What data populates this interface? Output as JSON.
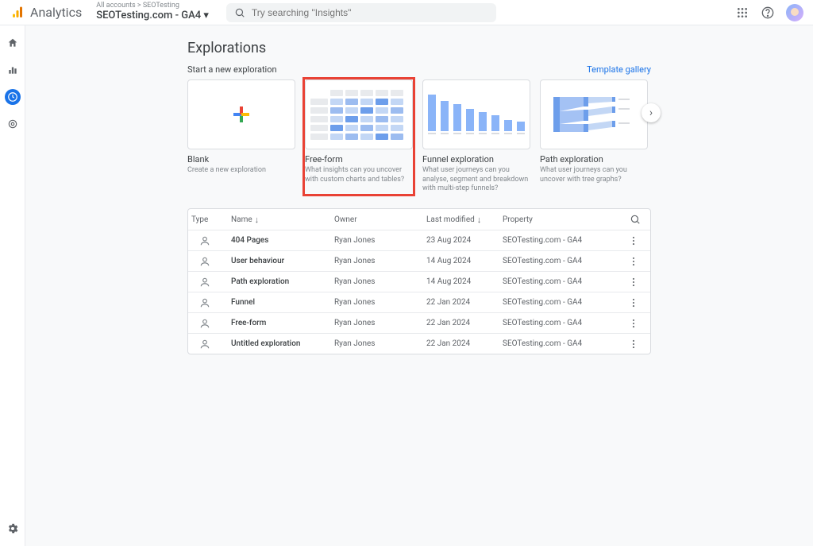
{
  "header": {
    "brand": "Analytics",
    "breadcrumb": "All accounts > SEOTesting",
    "property": "SEOTesting.com - GA4",
    "search_placeholder": "Try searching \"Insights\""
  },
  "page": {
    "title": "Explorations",
    "subtitle": "Start a new exploration",
    "gallery_link": "Template gallery"
  },
  "templates": [
    {
      "title": "Blank",
      "desc": "Create a new exploration"
    },
    {
      "title": "Free-form",
      "desc": "What insights can you uncover with custom charts and tables?"
    },
    {
      "title": "Funnel exploration",
      "desc": "What user journeys can you analyse, segment and breakdown with multi-step funnels?"
    },
    {
      "title": "Path exploration",
      "desc": "What user journeys can you uncover with tree graphs?"
    }
  ],
  "table": {
    "headers": {
      "type": "Type",
      "name": "Name",
      "owner": "Owner",
      "last_modified": "Last modified",
      "property": "Property"
    },
    "rows": [
      {
        "name": "404 Pages",
        "owner": "Ryan Jones",
        "modified": "23 Aug 2024",
        "property": "SEOTesting.com - GA4"
      },
      {
        "name": "User behaviour",
        "owner": "Ryan Jones",
        "modified": "14 Aug 2024",
        "property": "SEOTesting.com - GA4"
      },
      {
        "name": "Path exploration",
        "owner": "Ryan Jones",
        "modified": "14 Aug 2024",
        "property": "SEOTesting.com - GA4"
      },
      {
        "name": "Funnel",
        "owner": "Ryan Jones",
        "modified": "22 Jan 2024",
        "property": "SEOTesting.com - GA4"
      },
      {
        "name": "Free-form",
        "owner": "Ryan Jones",
        "modified": "22 Jan 2024",
        "property": "SEOTesting.com - GA4"
      },
      {
        "name": "Untitled exploration",
        "owner": "Ryan Jones",
        "modified": "22 Jan 2024",
        "property": "SEOTesting.com - GA4"
      }
    ]
  }
}
